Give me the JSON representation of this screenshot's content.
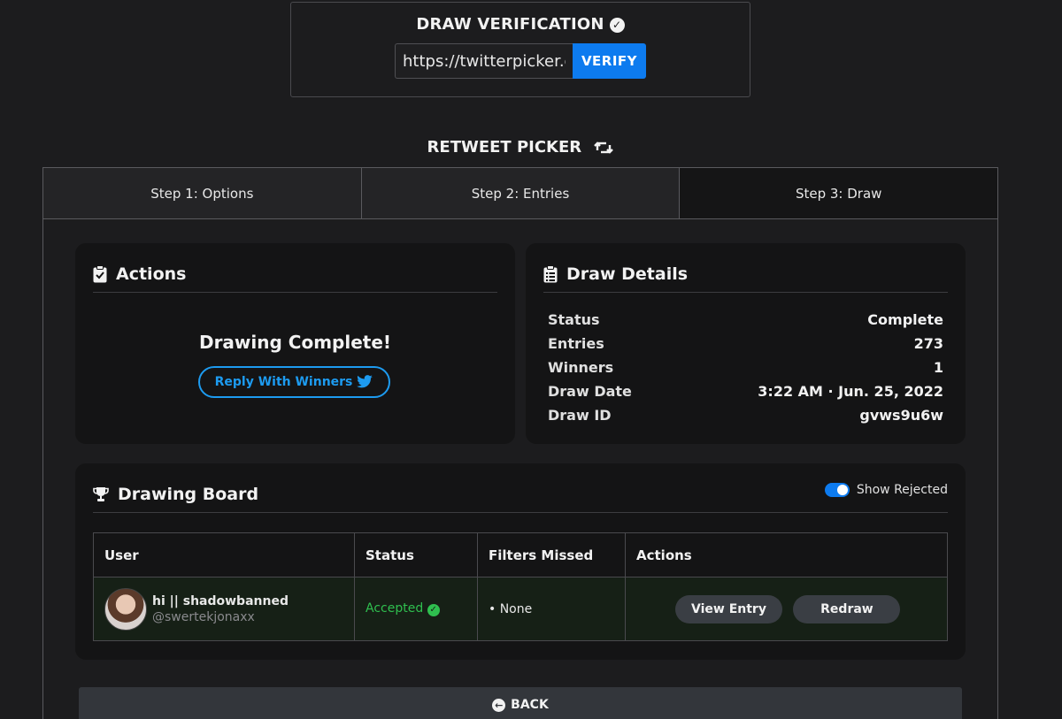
{
  "verification": {
    "title": "DRAW VERIFICATION",
    "check_glyph": "✓",
    "input_value": "https://twitterpicker.com",
    "button_label": "VERIFY"
  },
  "picker": {
    "title": "RETWEET PICKER",
    "icon": "retweet-icon"
  },
  "tabs": [
    {
      "label": "Step 1: Options"
    },
    {
      "label": "Step 2: Entries"
    },
    {
      "label": "Step 3: Draw",
      "active": true
    }
  ],
  "actions_card": {
    "title": "Actions",
    "icon": "clipboard-check-icon",
    "message": "Drawing Complete!",
    "reply_button": "Reply With Winners"
  },
  "details_card": {
    "title": "Draw Details",
    "icon": "clipboard-list-icon",
    "rows": [
      {
        "label": "Status",
        "value": "Complete"
      },
      {
        "label": "Entries",
        "value": "273"
      },
      {
        "label": "Winners",
        "value": "1"
      },
      {
        "label": "Draw Date",
        "value": "3:22 AM · Jun. 25, 2022"
      },
      {
        "label": "Draw ID",
        "value": "gvws9u6w"
      }
    ]
  },
  "board": {
    "title": "Drawing Board",
    "icon": "trophy-icon",
    "toggle_label": "Show Rejected",
    "toggle_on": true,
    "columns": [
      "User",
      "Status",
      "Filters Missed",
      "Actions"
    ],
    "rows": [
      {
        "name": "hi || shadowbanned",
        "handle": "@swertekjonaxx",
        "status": "Accepted",
        "filters_missed": "• None",
        "view_label": "View Entry",
        "redraw_label": "Redraw"
      }
    ]
  },
  "back_button": "BACK",
  "colors": {
    "background": "#1c1c1e",
    "card": "#141415",
    "accent_blue": "#0d7bef",
    "twitter_blue": "#1d9bf0",
    "accepted_green": "#2fbf4f"
  }
}
